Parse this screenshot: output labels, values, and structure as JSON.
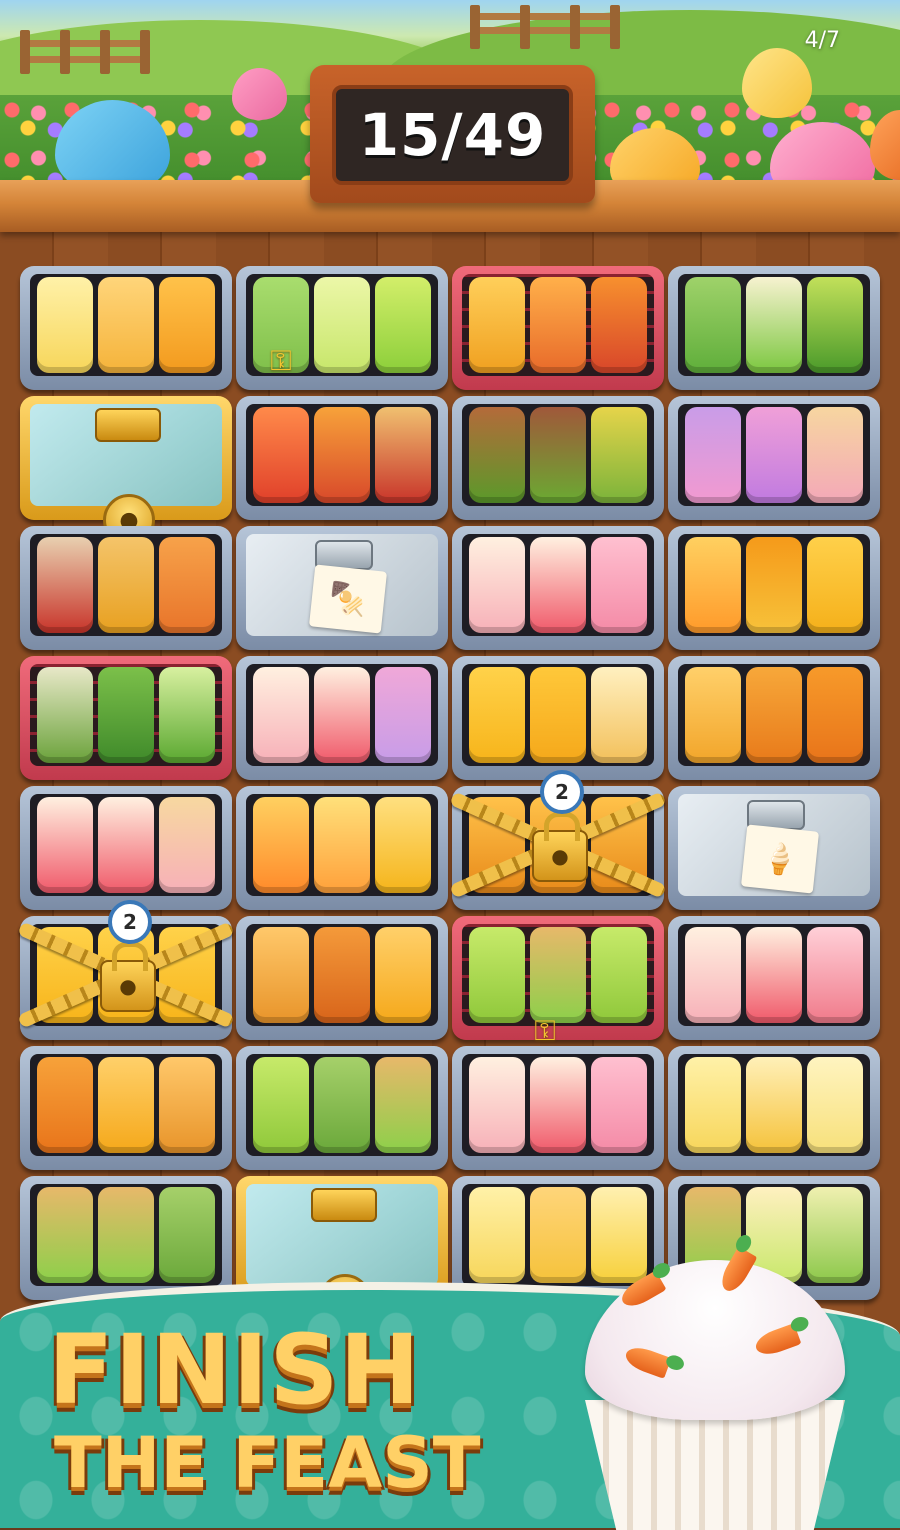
{
  "page_indicator": "4/7",
  "level_counter": {
    "text": "15/49"
  },
  "banner": {
    "line1": "FINISH",
    "line2": "THE FEAST"
  },
  "lock_counts": {
    "row5_col3": "2",
    "row6_col1": "2"
  },
  "icons": {
    "key": "key-icon",
    "padlock": "padlock-icon",
    "order_note_skewer": "skewer-icon",
    "order_note_icecream": "ice-cream-icon"
  },
  "palette": {
    "accent_teal": "#34b09a",
    "title_yellow": "#ffd066",
    "wood": "#8b4c22",
    "tray_steel": "#8fa0b8",
    "tray_red": "#d94a5c"
  },
  "trays": [
    {
      "type": "plain",
      "items": [
        [
          "#f7d65a",
          "#fff1a8"
        ],
        [
          "#f5b33a",
          "#ffd57a"
        ],
        [
          "#f39a1e",
          "#ffc24a"
        ]
      ]
    },
    {
      "type": "plain",
      "items": [
        [
          "#7fbf4a",
          "#a9dd6e"
        ],
        [
          "#c7e66a",
          "#ecf7a8"
        ],
        [
          "#8ccf3a",
          "#d3ee6a"
        ]
      ],
      "key": true
    },
    {
      "type": "red",
      "items": [
        [
          "#f0a020",
          "#ffcf5a"
        ],
        [
          "#e86a2a",
          "#ffb04a"
        ],
        [
          "#d8462a",
          "#f7902e"
        ]
      ]
    },
    {
      "type": "plain",
      "items": [
        [
          "#5fae3a",
          "#9fd26a"
        ],
        [
          "#7bc73f",
          "#f7f2d0"
        ],
        [
          "#4a9a2a",
          "#c2e05a"
        ]
      ]
    },
    {
      "type": "glass"
    },
    {
      "type": "plain",
      "items": [
        [
          "#e0402a",
          "#ff8a4a"
        ],
        [
          "#d8482a",
          "#f7a23a"
        ],
        [
          "#c8342a",
          "#f0c070"
        ]
      ]
    },
    {
      "type": "plain",
      "items": [
        [
          "#5a9a2a",
          "#b46a3a"
        ],
        [
          "#6aaa32",
          "#a0583a"
        ],
        [
          "#7ab33a",
          "#e6d44a"
        ]
      ]
    },
    {
      "type": "plain",
      "items": [
        [
          "#f29ad0",
          "#c99ce8"
        ],
        [
          "#c07ae0",
          "#f0a0d8"
        ],
        [
          "#f3a8b8",
          "#f7d6a0"
        ]
      ]
    },
    {
      "type": "plain",
      "items": [
        [
          "#c8342a",
          "#e8d0b0"
        ],
        [
          "#e8a020",
          "#f4c46a"
        ],
        [
          "#e8742a",
          "#f7a24a"
        ]
      ]
    },
    {
      "type": "covered",
      "note": "skewer"
    },
    {
      "type": "plain",
      "items": [
        [
          "#f7b0b8",
          "#fff0e0"
        ],
        [
          "#f0596a",
          "#fff0e0"
        ],
        [
          "#f48aa6",
          "#ffc0d0"
        ]
      ]
    },
    {
      "type": "plain",
      "items": [
        [
          "#ff9a2a",
          "#ffd060"
        ],
        [
          "#f7c23a",
          "#f59a1a"
        ],
        [
          "#f5b01a",
          "#ffd04a"
        ]
      ]
    },
    {
      "type": "red",
      "items": [
        [
          "#6aa23a",
          "#e8e8c8"
        ],
        [
          "#3f8a2a",
          "#7cc04a"
        ],
        [
          "#5aa830",
          "#d8f0a0"
        ]
      ]
    },
    {
      "type": "plain",
      "items": [
        [
          "#f7b0b8",
          "#fff0e0"
        ],
        [
          "#f0596a",
          "#fff0e0"
        ],
        [
          "#c79ce8",
          "#f0a8d8"
        ]
      ]
    },
    {
      "type": "plain",
      "items": [
        [
          "#f7b41a",
          "#ffd24a"
        ],
        [
          "#f5a81a",
          "#ffc83a"
        ],
        [
          "#f3c05a",
          "#fff0c0"
        ]
      ]
    },
    {
      "type": "plain",
      "items": [
        [
          "#f2a52a",
          "#ffd06a"
        ],
        [
          "#e87a1a",
          "#f7a83a"
        ],
        [
          "#e8741a",
          "#f79a2a"
        ]
      ]
    },
    {
      "type": "plain",
      "items": [
        [
          "#f0596a",
          "#fff0e0"
        ],
        [
          "#f05a6a",
          "#fff0e0"
        ],
        [
          "#f7b0b8",
          "#f7d8a0"
        ]
      ]
    },
    {
      "type": "plain",
      "items": [
        [
          "#ff8a2a",
          "#ffd060"
        ],
        [
          "#ffa03a",
          "#ffe07a"
        ],
        [
          "#f5b41a",
          "#ffe080"
        ]
      ]
    },
    {
      "type": "chained",
      "badge_key": "row5_col3",
      "items": [
        [
          "#e88a1a",
          "#ffc24a"
        ],
        [
          "#e88a1a",
          "#ffc24a"
        ],
        [
          "#e88a1a",
          "#ffc24a"
        ]
      ]
    },
    {
      "type": "covered",
      "note": "icecream"
    },
    {
      "type": "chained",
      "badge_key": "row6_col1",
      "items": [
        [
          "#f7b41a",
          "#ffd24a"
        ],
        [
          "#f7b41a",
          "#ffd24a"
        ],
        [
          "#f7b41a",
          "#ffd24a"
        ]
      ]
    },
    {
      "type": "plain",
      "items": [
        [
          "#e8942a",
          "#ffc86a"
        ],
        [
          "#d8641a",
          "#f49a3a"
        ],
        [
          "#f5a81a",
          "#ffd06a"
        ]
      ]
    },
    {
      "type": "red",
      "items": [
        [
          "#8fc83a",
          "#c7ea6a"
        ],
        [
          "#8cd04a",
          "#e7b86a"
        ],
        [
          "#8fc83a",
          "#c7ea6a"
        ]
      ],
      "key": true
    },
    {
      "type": "plain",
      "items": [
        [
          "#f7b0b8",
          "#fff0e0"
        ],
        [
          "#f0596a",
          "#fff0e0"
        ],
        [
          "#f07a8a",
          "#ffd0d8"
        ]
      ]
    },
    {
      "type": "plain",
      "items": [
        [
          "#e8741a",
          "#f7a23a"
        ],
        [
          "#f5a81a",
          "#ffd06a"
        ],
        [
          "#e8942a",
          "#ffc86a"
        ]
      ]
    },
    {
      "type": "plain",
      "items": [
        [
          "#8fc83a",
          "#c7ea6a"
        ],
        [
          "#6aa83a",
          "#a6d06a"
        ],
        [
          "#8cd04a",
          "#e7b86a"
        ]
      ]
    },
    {
      "type": "plain",
      "items": [
        [
          "#f7b0b8",
          "#fff0e0"
        ],
        [
          "#f0596a",
          "#fff0e0"
        ],
        [
          "#f48aa6",
          "#ffc0d0"
        ]
      ]
    },
    {
      "type": "plain",
      "items": [
        [
          "#f7d65a",
          "#fff1a8"
        ],
        [
          "#f5c23a",
          "#fff0b8"
        ],
        [
          "#f7e07a",
          "#fff4c0"
        ]
      ]
    },
    {
      "type": "plain",
      "items": [
        [
          "#8cd04a",
          "#e7b86a"
        ],
        [
          "#8cd04a",
          "#e7b86a"
        ],
        [
          "#6aa83a",
          "#a6d06a"
        ]
      ]
    },
    {
      "type": "glass"
    },
    {
      "type": "plain",
      "items": [
        [
          "#f7d65a",
          "#fff1a8"
        ],
        [
          "#f5c23a",
          "#ffd57a"
        ],
        [
          "#f7d03a",
          "#fff0b0"
        ]
      ]
    },
    {
      "type": "plain",
      "items": [
        [
          "#8cd04a",
          "#e7b86a"
        ],
        [
          "#c8e86a",
          "#fff0c0"
        ],
        [
          "#8cc84a",
          "#f0f0b0"
        ]
      ]
    }
  ]
}
